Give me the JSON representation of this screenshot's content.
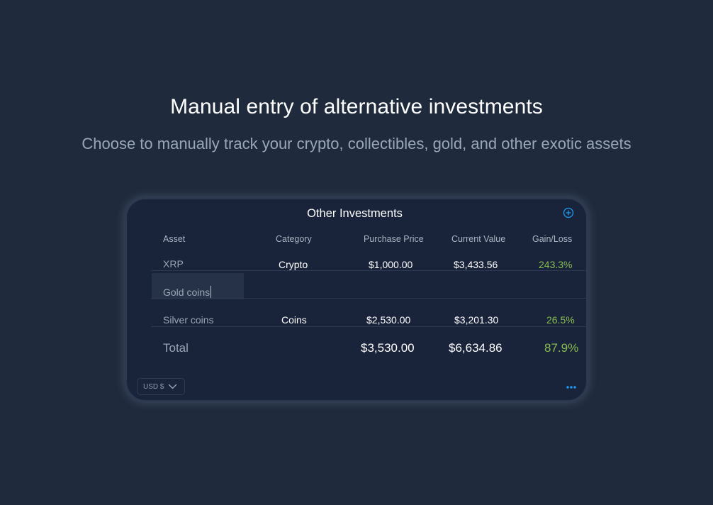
{
  "hero": {
    "title": "Manual entry of alternative investments",
    "subtitle": "Choose to manually track your crypto, collectibles, gold, and other exotic assets"
  },
  "card": {
    "title": "Other Investments",
    "add_icon": "plus-circle-icon",
    "more_icon": "ellipsis-icon",
    "accent_color": "#1e9bf0",
    "gain_color": "#88bd4f",
    "currency": "USD $",
    "currency_icon": "chevron-down-icon"
  },
  "table": {
    "columns": [
      "Asset",
      "Category",
      "Purchase Price",
      "Current Value",
      "Gain/Loss"
    ],
    "rows": [
      {
        "asset": "XRP",
        "category": "Crypto",
        "purchase": "$1,000.00",
        "current": "$3,433.56",
        "gain": "243.3%"
      },
      {
        "asset": "Gold coins",
        "category": "",
        "purchase": "",
        "current": "",
        "gain": "",
        "editing": true
      },
      {
        "asset": "Silver coins",
        "category": "Coins",
        "purchase": "$2,530.00",
        "current": "$3,201.30",
        "gain": "26.5%"
      }
    ],
    "total": {
      "label": "Total",
      "purchase": "$3,530.00",
      "current": "$6,634.86",
      "gain": "87.9%"
    }
  }
}
